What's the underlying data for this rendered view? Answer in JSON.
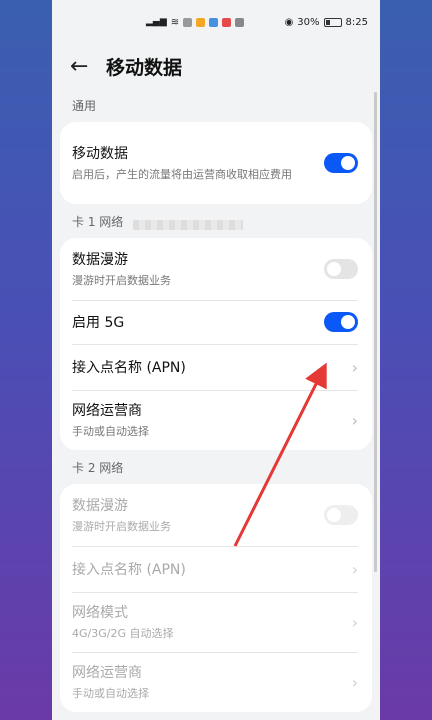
{
  "status": {
    "battery": "30%",
    "time": "8:25",
    "battery_level": 0.3
  },
  "header": {
    "title": "移动数据"
  },
  "general": {
    "label": "通用",
    "mobile_data": {
      "title": "移动数据",
      "subtitle": "启用后，产生的流量将由运营商收取相应费用",
      "on": true
    }
  },
  "sim1": {
    "label": "卡 1 网络",
    "roaming": {
      "title": "数据漫游",
      "subtitle": "漫游时开启数据业务",
      "on": false
    },
    "five_g": {
      "title": "启用 5G",
      "on": true
    },
    "apn": {
      "title": "接入点名称 (APN)"
    },
    "carrier": {
      "title": "网络运营商",
      "subtitle": "手动或自动选择"
    }
  },
  "sim2": {
    "label": "卡 2 网络",
    "roaming": {
      "title": "数据漫游",
      "subtitle": "漫游时开启数据业务",
      "on": false
    },
    "apn": {
      "title": "接入点名称 (APN)"
    },
    "mode": {
      "title": "网络模式",
      "subtitle": "4G/3G/2G 自动选择"
    },
    "carrier": {
      "title": "网络运营商",
      "subtitle": "手动或自动选择"
    }
  },
  "colors": {
    "accent": "#0a59f7",
    "annotation": "#e53935"
  },
  "icons": {
    "back": "back-arrow-icon",
    "chevron": "chevron-right-icon"
  }
}
